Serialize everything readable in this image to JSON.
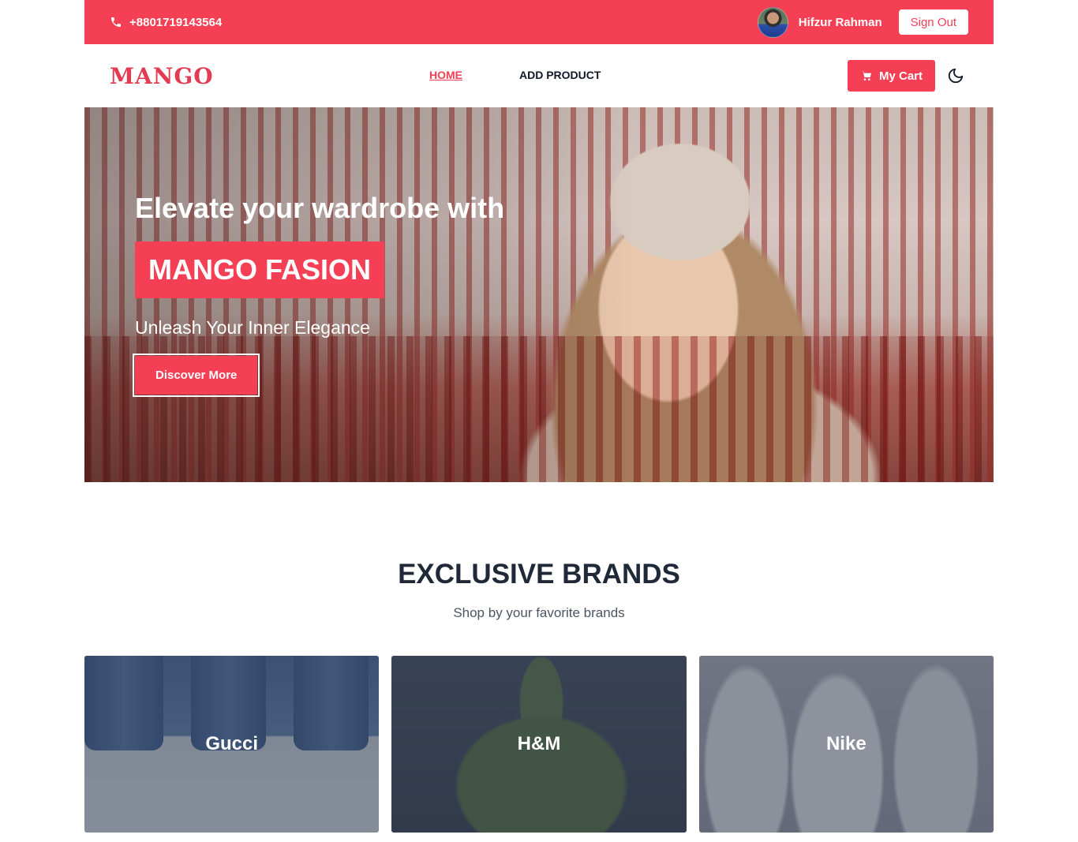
{
  "topbar": {
    "phone": "+8801719143564",
    "user_name": "Hifzur Rahman",
    "sign_out_label": "Sign Out",
    "background_color": "#f43f54"
  },
  "navbar": {
    "logo": "MANGO",
    "links": [
      {
        "label": "HOME",
        "active": true
      },
      {
        "label": "ADD PRODUCT",
        "active": false
      }
    ],
    "cart_label": "My Cart",
    "theme_toggle_icon": "moon-icon"
  },
  "hero": {
    "title": "Elevate your wardrobe with",
    "brand": "MANGO FASION",
    "subtitle": "Unleash Your Inner Elegance",
    "cta_label": "Discover More"
  },
  "brands": {
    "title": "EXCLUSIVE BRANDS",
    "subtitle": "Shop by your favorite brands",
    "items": [
      {
        "name": "Gucci"
      },
      {
        "name": "H&M"
      },
      {
        "name": "Nike"
      }
    ]
  },
  "colors": {
    "accent": "#f43f54",
    "heading": "#1f2937"
  }
}
